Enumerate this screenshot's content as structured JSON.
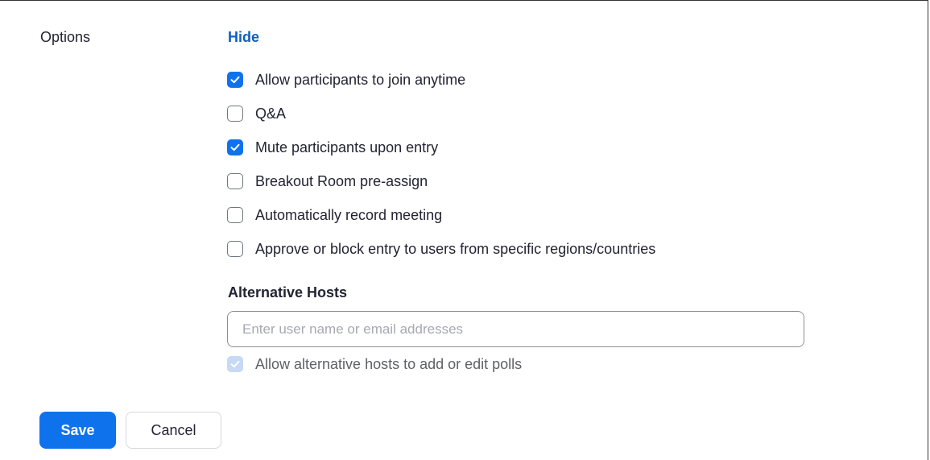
{
  "options": {
    "label": "Options",
    "toggle_link": "Hide",
    "checkboxes": [
      {
        "label": "Allow participants to join anytime",
        "checked": true
      },
      {
        "label": "Q&A",
        "checked": false
      },
      {
        "label": "Mute participants upon entry",
        "checked": true
      },
      {
        "label": "Breakout Room pre-assign",
        "checked": false
      },
      {
        "label": "Automatically record meeting",
        "checked": false
      },
      {
        "label": "Approve or block entry to users from specific regions/countries",
        "checked": false
      }
    ]
  },
  "alternative_hosts": {
    "title": "Alternative Hosts",
    "input_placeholder": "Enter user name or email addresses",
    "input_value": "",
    "poll_option": {
      "label": "Allow alternative hosts to add or edit polls",
      "checked": true,
      "disabled": true
    }
  },
  "actions": {
    "save_label": "Save",
    "cancel_label": "Cancel"
  },
  "colors": {
    "accent": "#0e72ed",
    "link": "#0e5fc1",
    "text": "#232333"
  }
}
